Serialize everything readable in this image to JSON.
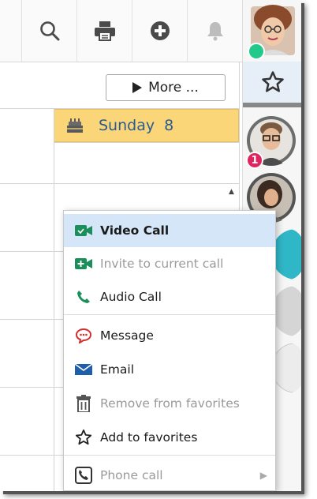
{
  "toolbar": {
    "icons": [
      "search-icon",
      "print-icon",
      "add-icon",
      "bell-icon"
    ]
  },
  "calendar": {
    "more_label": "More ...",
    "day_label": "Sunday  8"
  },
  "rail": {
    "me_status_color": "#22c98a",
    "contact1_badge": "1"
  },
  "menu": {
    "video_call": "Video Call",
    "invite": "Invite to current call",
    "audio_call": "Audio Call",
    "message": "Message",
    "email": "Email",
    "remove_fav": "Remove from favorites",
    "add_fav": "Add to favorites",
    "phone_call": "Phone call"
  },
  "colors": {
    "accent_green": "#1a8f5a",
    "day_header_bg": "#fbd679",
    "menu_active_bg": "#d5e6f8",
    "badge_red": "#e0245e",
    "email_blue": "#1f5ea8"
  }
}
